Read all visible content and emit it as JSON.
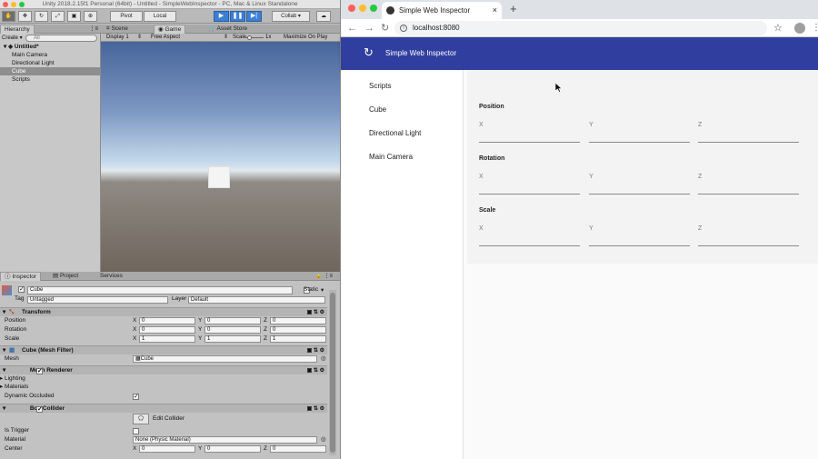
{
  "unity": {
    "window_title": "Unity 2018.2.15f1 Personal (64bit) - Untitled - SimpleWebInspector - PC, Mac & Linux Standalone",
    "toolbar": {
      "pivot": "Pivot",
      "local": "Local",
      "collab": "Collab ▾"
    },
    "hierarchy": {
      "tab": "Hierarchy",
      "create": "Create ▾",
      "search_placeholder": "All",
      "scene_name": "Untitled*",
      "items": [
        "Main Camera",
        "Directional Light",
        "Cube",
        "Scripts"
      ],
      "selected": "Cube"
    },
    "view_tabs": [
      "Scene",
      "Game",
      "Asset Store"
    ],
    "game_bar": {
      "display": "Display 1",
      "aspect": "Free Aspect",
      "scale_label": "Scale",
      "scale_value": "1x",
      "maximize": "Maximize On Play"
    },
    "inspector": {
      "tabs": [
        "Inspector",
        "Project",
        "Services"
      ],
      "object_name": "Cube",
      "static_label": "Static",
      "tag_label": "Tag",
      "tag_value": "Untagged",
      "layer_label": "Layer",
      "layer_value": "Default",
      "transform": {
        "title": "Transform",
        "position": {
          "label": "Position",
          "x": "0",
          "y": "0",
          "z": "0"
        },
        "rotation": {
          "label": "Rotation",
          "x": "0",
          "y": "0",
          "z": "0"
        },
        "scale": {
          "label": "Scale",
          "x": "1",
          "y": "1",
          "z": "1"
        }
      },
      "mesh_filter": {
        "title": "Cube (Mesh Filter)",
        "mesh_label": "Mesh",
        "mesh_value": "Cube"
      },
      "mesh_renderer": {
        "title": "Mesh Renderer",
        "lighting": "Lighting",
        "materials": "Materials",
        "dynamic_occluded": "Dynamic Occluded"
      },
      "box_collider": {
        "title": "Box Collider",
        "edit": "Edit Collider",
        "is_trigger": "Is Trigger",
        "material_label": "Material",
        "material_value": "None (Physic Material)",
        "center_label": "Center",
        "center": {
          "x": "0",
          "y": "0",
          "z": "0"
        }
      }
    }
  },
  "browser": {
    "tab_title": "Simple Web Inspector",
    "new_tab": "+",
    "url": "localhost:8080",
    "app_title": "Simple Web Inspector",
    "nav_items": [
      "Scripts",
      "Cube",
      "Directional Light",
      "Main Camera"
    ],
    "sections": [
      {
        "title": "Position",
        "fields": [
          "X",
          "Y",
          "Z"
        ]
      },
      {
        "title": "Rotation",
        "fields": [
          "X",
          "Y",
          "Z"
        ]
      },
      {
        "title": "Scale",
        "fields": [
          "X",
          "Y",
          "Z"
        ]
      }
    ],
    "accent_color": "#303f9f"
  }
}
